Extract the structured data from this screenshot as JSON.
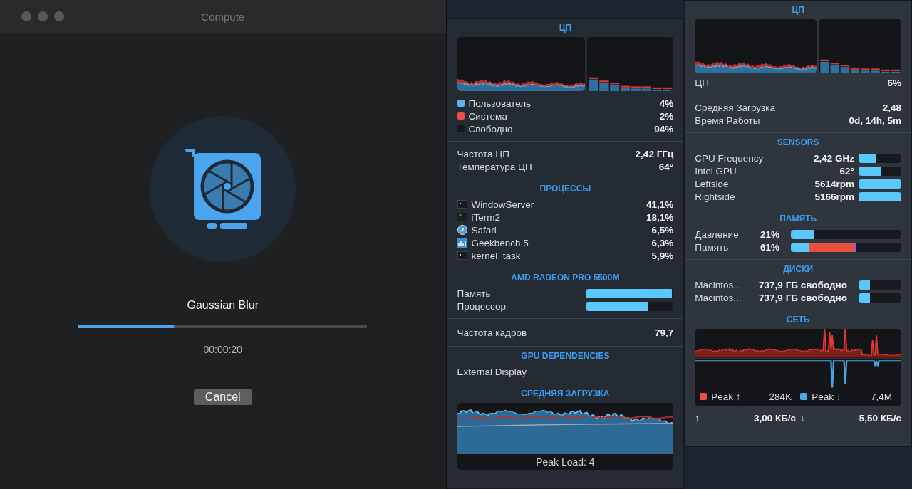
{
  "window": {
    "title": "Compute",
    "task": "Gaussian Blur",
    "progress": {
      "level": 0.33
    },
    "elapsed": "00:00:20",
    "button": "Cancel"
  },
  "cpu_panel": {
    "title": "ЦП",
    "legend": [
      {
        "label": "Пользователь",
        "value": "4%",
        "color": "#5ab4f0"
      },
      {
        "label": "Система",
        "value": "2%",
        "color": "#e9503f"
      },
      {
        "label": "Свободно",
        "value": "94%",
        "color": "#14171b"
      }
    ],
    "stats": [
      {
        "label": "Частота ЦП",
        "value": "2,42 ГГц"
      },
      {
        "label": "Температура ЦП",
        "value": "64°"
      }
    ],
    "processes_title": "ПРОЦЕССЫ",
    "processes": [
      {
        "name": "WindowServer",
        "value": "41,1%",
        "kind": "terminal"
      },
      {
        "name": "iTerm2",
        "value": "18,1%",
        "kind": "console"
      },
      {
        "name": "Safari",
        "value": "6,5%",
        "kind": "compass"
      },
      {
        "name": "Geekbench 5",
        "value": "6,3%",
        "kind": "chart"
      },
      {
        "name": "kernel_task",
        "value": "5,9%",
        "kind": "terminal"
      }
    ],
    "gpu": {
      "title": "AMD RADEON PRO 5500M",
      "meters": [
        {
          "label": "Память",
          "level": 0.98
        },
        {
          "label": "Процессор",
          "level": 0.71
        }
      ]
    },
    "frame_rate": {
      "label": "Частота кадров",
      "value": "79,7"
    },
    "dependencies": {
      "title": "GPU DEPENDENCIES",
      "items": [
        "External Display"
      ]
    },
    "load": {
      "title": "СРЕДНЯЯ ЗАГРУЗКА",
      "caption": "Peak Load: 4"
    }
  },
  "stats_panel": {
    "cpu": {
      "title": "ЦП",
      "label": "ЦП",
      "value": "6%"
    },
    "summary": [
      {
        "label": "Средняя Загрузка",
        "value": "2,48"
      },
      {
        "label": "Время Работы",
        "value": "0d, 14h, 5m"
      }
    ],
    "sensors": {
      "title": "SENSORS",
      "items": [
        {
          "label": "CPU Frequency",
          "value": "2,42 GHz",
          "level": 0.4
        },
        {
          "label": "Intel GPU",
          "value": "62°",
          "level": 0.52
        },
        {
          "label": "Leftside",
          "value": "5614rpm",
          "level": 1
        },
        {
          "label": "Rightside",
          "value": "5166rpm",
          "level": 1
        }
      ]
    },
    "memory": {
      "title": "ПАМЯТЬ",
      "items": [
        {
          "label": "Давление",
          "value": "21%",
          "segments": [
            {
              "level": 0.21,
              "color": "#5ac8fa"
            }
          ]
        },
        {
          "label": "Память",
          "value": "61%",
          "segments": [
            {
              "level": 0.17,
              "color": "#5ac8fa"
            },
            {
              "level": 0.4,
              "color": "#e9503f"
            },
            {
              "level": 0.02,
              "color": "#a25ddc"
            }
          ]
        }
      ]
    },
    "disks": {
      "title": "ДИСКИ",
      "items": [
        {
          "name": "Macintos...",
          "value": "737,9 ГБ свободно",
          "level": 0.27
        },
        {
          "name": "Macintos...",
          "value": "737,9 ГБ свободно",
          "level": 0.27
        }
      ]
    },
    "network": {
      "title": "СЕТЬ",
      "legend": [
        {
          "label": "Peak ↑",
          "value": "284K",
          "color": "#e9503f"
        },
        {
          "label": "Peak ↓",
          "value": "7,4M",
          "color": "#4aa8e8"
        }
      ],
      "up_arrow": "↑",
      "up": "3,00 КБ/с",
      "down_arrow": "↓",
      "down": "5,50 КБ/с"
    }
  }
}
